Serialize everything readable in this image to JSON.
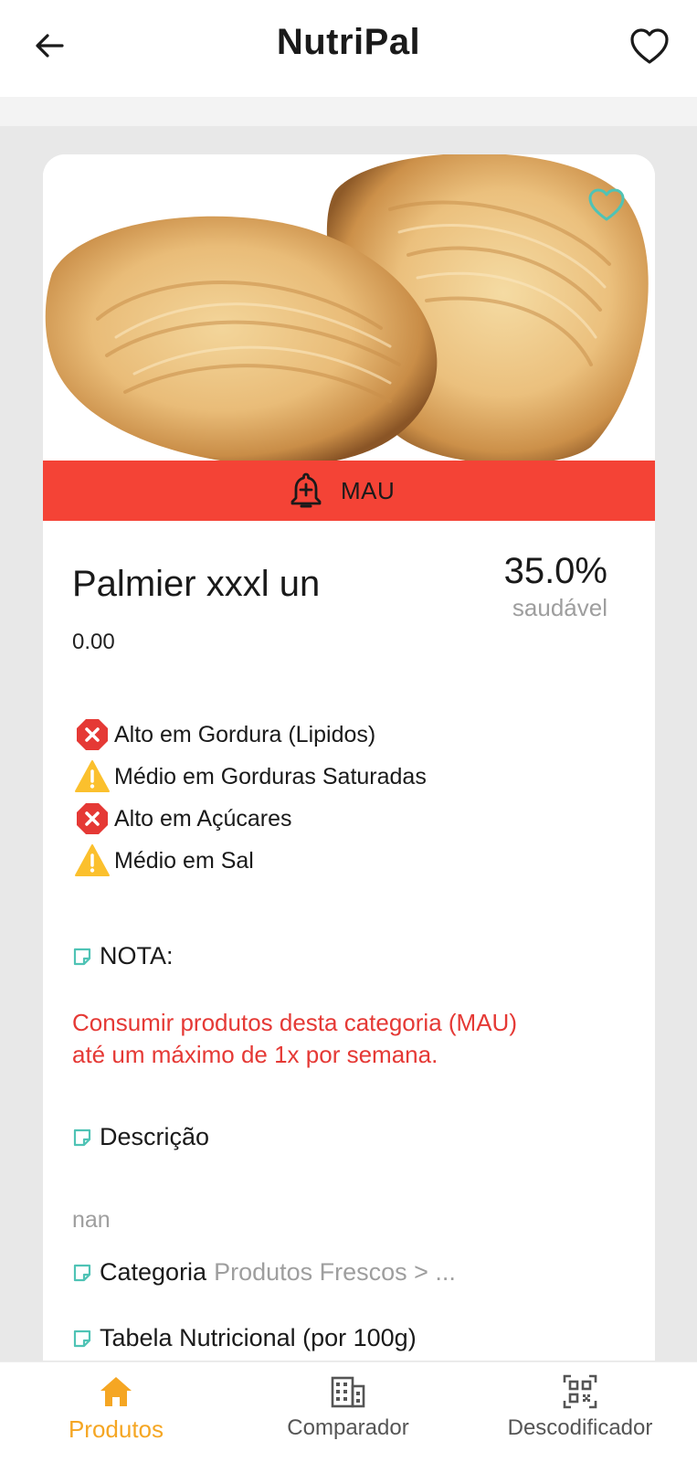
{
  "header": {
    "title": "NutriPal"
  },
  "product": {
    "rating_label": "MAU",
    "name": "Palmier xxxl un",
    "price": "0.00",
    "health_percent": "35.0%",
    "health_label": "saudável"
  },
  "warnings": [
    {
      "type": "high",
      "icon": "x-circle-icon",
      "text": "Alto em Gordura (Lipidos)"
    },
    {
      "type": "medium",
      "icon": "warning-triangle-icon",
      "text": "Médio em Gorduras Saturadas"
    },
    {
      "type": "high",
      "icon": "x-circle-icon",
      "text": "Alto em Açúcares"
    },
    {
      "type": "medium",
      "icon": "warning-triangle-icon",
      "text": "Médio em Sal"
    }
  ],
  "sections": {
    "nota_label": "NOTA:",
    "nota_text": "Consumir produtos desta categoria (MAU) até um máximo de 1x por semana.",
    "descricao_label": "Descrição",
    "descricao_value": "nan",
    "categoria_label": "Categoria",
    "categoria_value": "Produtos Frescos > ...",
    "tabela_label": "Tabela Nutricional (por 100g)"
  },
  "bottom_nav": [
    {
      "label": "Produtos",
      "icon": "home-icon",
      "active": true
    },
    {
      "label": "Comparador",
      "icon": "building-icon",
      "active": false
    },
    {
      "label": "Descodificador",
      "icon": "qr-code-icon",
      "active": false
    }
  ],
  "colors": {
    "bad": "#f44336",
    "accent": "#f5a623",
    "teal": "#4fc3b5",
    "warning": "#fbc02d",
    "note_text": "#e53935"
  }
}
